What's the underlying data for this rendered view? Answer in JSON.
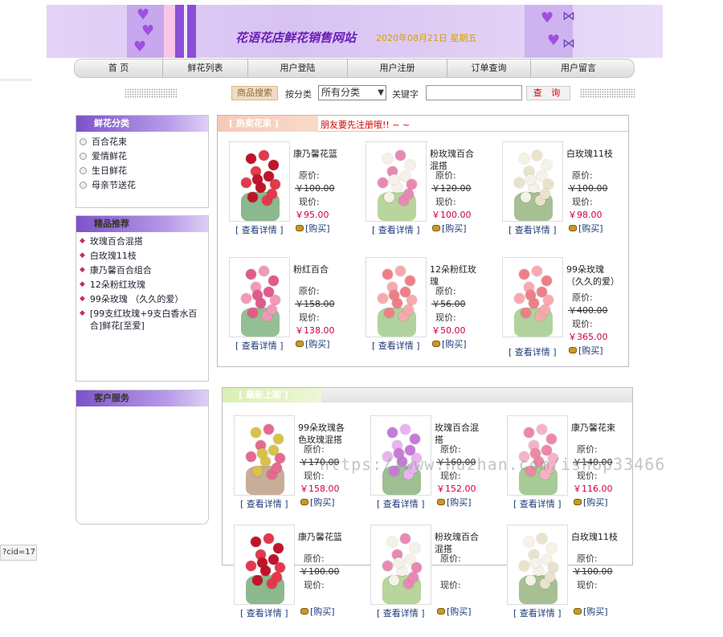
{
  "header": {
    "site_title": "花语花店鲜花销售网站",
    "date": "2020年08月21日 星期五"
  },
  "nav": [
    "首 页",
    "鲜花列表",
    "用户登陆",
    "用户注册",
    "订单查询",
    "用户留言"
  ],
  "search": {
    "title": "商品搜索",
    "category_label": "按分类",
    "category_value": "所有分类",
    "keyword_label": "关键字",
    "button": "查 询"
  },
  "sidebar": {
    "categories": {
      "title": "鲜花分类",
      "items": [
        "百合花束",
        "爱情鲜花",
        "生日鲜花",
        "母亲节送花"
      ]
    },
    "recommend": {
      "title": "精品推荐",
      "items": [
        "玫瑰百合混搭",
        "白玫瑰11枝",
        "康乃馨百合组合",
        "12朵粉红玫瑰",
        "99朵玫瑰 （久久的爱）",
        "[99支红玫瑰+9支白香水百合]鲜花[至爱]"
      ]
    },
    "service": {
      "title": "客户服务"
    }
  },
  "hot": {
    "tab": "[ 热卖花束 ]",
    "marquee": "朋友要先注册哦!! ~ ~",
    "products": [
      {
        "name": "康乃馨花篮",
        "orig": "￥100.00",
        "now": "￥95.00"
      },
      {
        "name": "粉玫瑰百合混搭",
        "orig": "￥120.00",
        "now": "￥100.00"
      },
      {
        "name": "白玫瑰11枝",
        "orig": "￥100.00",
        "now": "￥98.00"
      },
      {
        "name": "粉红百合",
        "orig": "￥158.00",
        "now": "￥138.00"
      },
      {
        "name": "12朵粉红玫瑰",
        "orig": "￥56.00",
        "now": "￥50.00"
      },
      {
        "name": "99朵玫瑰 （久久的爱）",
        "orig": "￥400.00",
        "now": "￥365.00"
      }
    ]
  },
  "newest": {
    "tab": "[ 最新上架 ]",
    "products": [
      {
        "name": "99朵玫瑰各色玫瑰混搭",
        "orig": "￥170.00",
        "now": "￥158.00"
      },
      {
        "name": "玫瑰百合混搭",
        "orig": "￥160.00",
        "now": "￥152.00"
      },
      {
        "name": "康乃馨花束",
        "orig": "￥140.00",
        "now": "￥116.00"
      },
      {
        "name": "康乃馨花篮",
        "orig": "￥100.00",
        "now": ""
      },
      {
        "name": "粉玫瑰百合混搭",
        "orig": "",
        "now": ""
      },
      {
        "name": "白玫瑰11枝",
        "orig": "￥100.00",
        "now": ""
      }
    ]
  },
  "labels": {
    "orig_price": "原价:",
    "now_price": "现价:",
    "detail": "[ 查看详情 ]",
    "buy": "[购买]"
  },
  "watermark": "https://www.huzhan.com/ishop33466",
  "status_bar": "?cid=17"
}
